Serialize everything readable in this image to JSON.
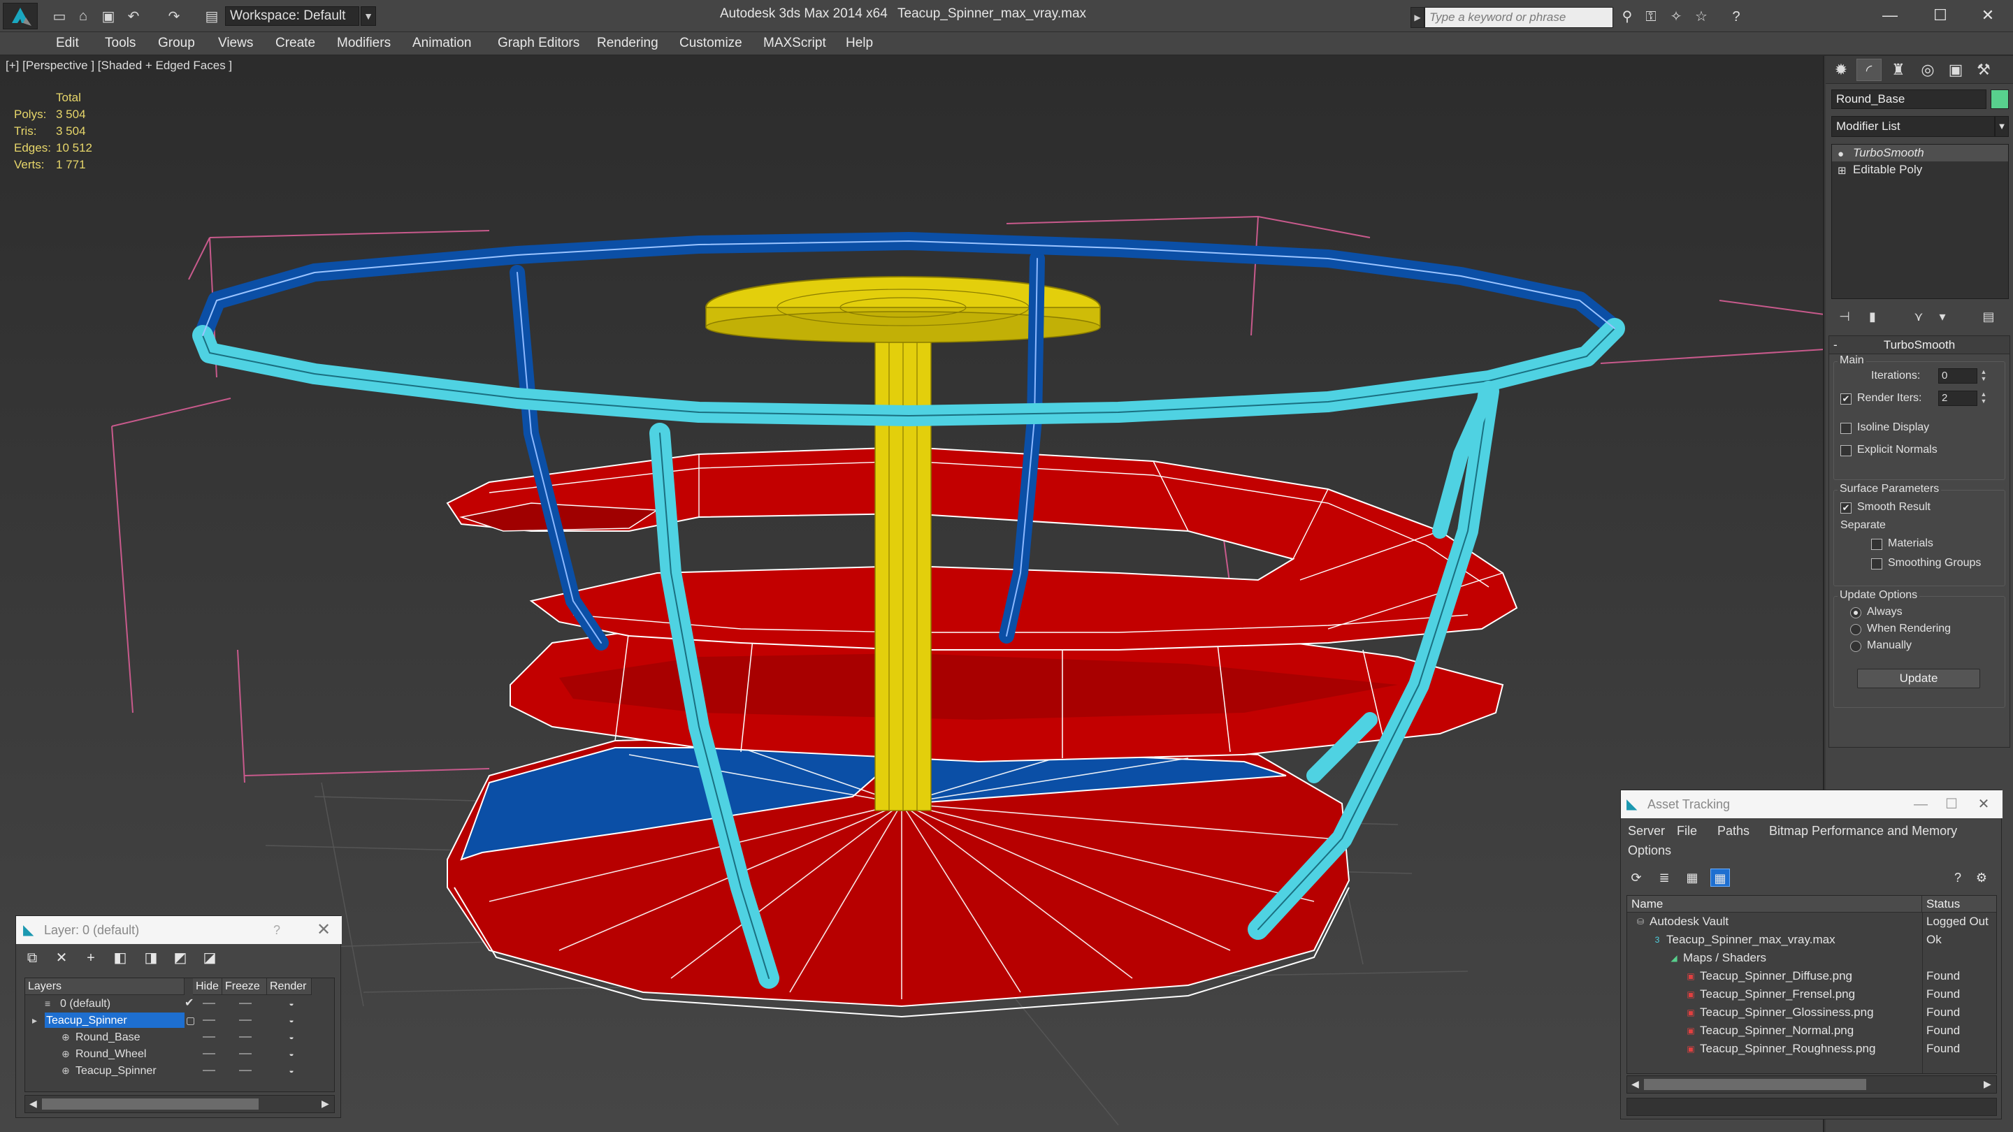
{
  "titlebar": {
    "app_title": "Autodesk 3ds Max  2014 x64",
    "file_name": "Teacup_Spinner_max_vray.max",
    "workspace": "Workspace: Default",
    "search_placeholder": "Type a keyword or phrase"
  },
  "menu": [
    "Edit",
    "Tools",
    "Group",
    "Views",
    "Create",
    "Modifiers",
    "Animation",
    "Graph Editors",
    "Rendering",
    "Customize",
    "MAXScript",
    "Help"
  ],
  "viewport": {
    "label": "[+] [Perspective ] [Shaded + Edged Faces ]",
    "stats": {
      "header": "Total",
      "polys_label": "Polys:",
      "polys": "3 504",
      "tris_label": "Tris:",
      "tris": "3 504",
      "edges_label": "Edges:",
      "edges": "10 512",
      "verts_label": "Verts:",
      "verts": "1 771"
    }
  },
  "colors": {
    "yellow": "#e3cf0c",
    "red": "#c80000",
    "blue": "#0a4fa8",
    "cyan": "#4fd2e2",
    "object_color": "#58d08d",
    "selection": "#1e6fd0"
  },
  "command_panel": {
    "object_name": "Round_Base",
    "modifier_list": "Modifier List",
    "stack": [
      "TurboSmooth",
      "Editable Poly"
    ],
    "turbosmooth": {
      "title": "TurboSmooth",
      "main_label": "Main",
      "iterations_label": "Iterations:",
      "iterations": "0",
      "render_iters_label": "Render Iters:",
      "render_iters": "2",
      "render_iters_checked": true,
      "isoline_label": "Isoline Display",
      "isoline_checked": false,
      "explicit_label": "Explicit Normals",
      "explicit_checked": false,
      "surface_label": "Surface Parameters",
      "smooth_result_label": "Smooth Result",
      "smooth_result_checked": true,
      "separate_label": "Separate",
      "materials_label": "Materials",
      "smoothing_groups_label": "Smoothing Groups",
      "update_options_label": "Update Options",
      "always_label": "Always",
      "when_rendering_label": "When Rendering",
      "manually_label": "Manually",
      "update_selected": "Always",
      "update_button": "Update"
    }
  },
  "layer_panel": {
    "title": "Layer: 0 (default)",
    "help": "?",
    "columns": [
      "Layers",
      "Hide",
      "Freeze",
      "Render"
    ],
    "rows": [
      {
        "name": "0 (default)",
        "indent": 1,
        "active": true,
        "selected": false
      },
      {
        "name": "Teacup_Spinner",
        "indent": 1,
        "active": false,
        "selected": true
      },
      {
        "name": "Round_Base",
        "indent": 2,
        "active": false,
        "selected": false
      },
      {
        "name": "Round_Wheel",
        "indent": 2,
        "active": false,
        "selected": false
      },
      {
        "name": "Teacup_Spinner",
        "indent": 2,
        "active": false,
        "selected": false
      }
    ]
  },
  "asset_panel": {
    "title": "Asset Tracking",
    "menu": [
      "Server",
      "File",
      "Paths",
      "Bitmap Performance and Memory",
      "Options"
    ],
    "columns": [
      "Name",
      "Status"
    ],
    "rows": [
      {
        "name": "Autodesk Vault",
        "status": "Logged Out",
        "indent": 0,
        "icon": "vault-icon"
      },
      {
        "name": "Teacup_Spinner_max_vray.max",
        "status": "Ok",
        "indent": 1,
        "icon": "max-file-icon"
      },
      {
        "name": "Maps / Shaders",
        "status": "",
        "indent": 2,
        "icon": "maps-icon"
      },
      {
        "name": "Teacup_Spinner_Diffuse.png",
        "status": "Found",
        "indent": 3,
        "icon": "png-icon"
      },
      {
        "name": "Teacup_Spinner_Frensel.png",
        "status": "Found",
        "indent": 3,
        "icon": "png-icon"
      },
      {
        "name": "Teacup_Spinner_Glossiness.png",
        "status": "Found",
        "indent": 3,
        "icon": "png-icon"
      },
      {
        "name": "Teacup_Spinner_Normal.png",
        "status": "Found",
        "indent": 3,
        "icon": "png-icon"
      },
      {
        "name": "Teacup_Spinner_Roughness.png",
        "status": "Found",
        "indent": 3,
        "icon": "png-icon"
      }
    ]
  }
}
